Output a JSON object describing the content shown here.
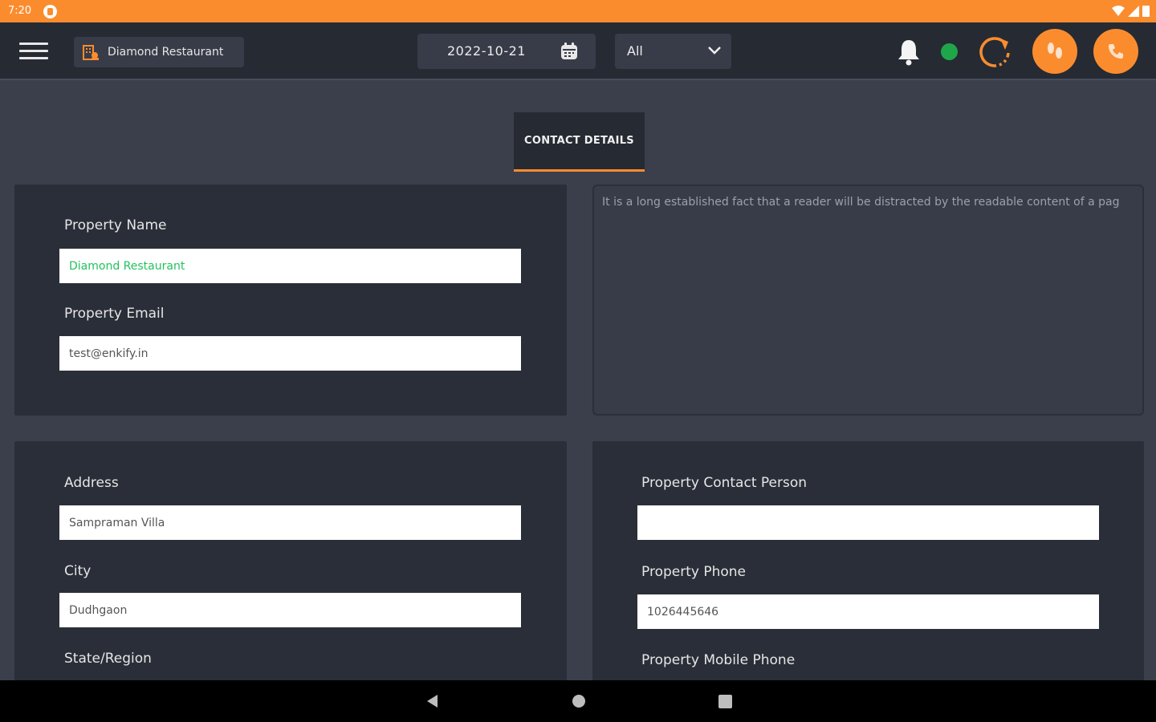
{
  "statusbar": {
    "time": "7:20"
  },
  "header": {
    "property_name": "Diamond Restaurant",
    "date": "2022-10-21",
    "filter_value": "All"
  },
  "tab": {
    "label": "CONTACT DETAILS"
  },
  "form": {
    "property_name_label": "Property Name",
    "property_name_value": "Diamond Restaurant",
    "property_email_label": "Property Email",
    "property_email_value": "test@enkify.in",
    "description_text": "It is a long established fact that a reader will be distracted by the readable content of a pag",
    "address_label": "Address",
    "address_value": "Sampraman Villa",
    "city_label": "City",
    "city_value": "Dudhgaon",
    "state_label": "State/Region",
    "contact_person_label": "Property Contact Person",
    "contact_person_value": "",
    "phone_label": "Property Phone",
    "phone_value": "1026445646",
    "mobile_label": "Property Mobile Phone"
  },
  "colors": {
    "accent": "#fb8c2e",
    "online": "#1fa64a",
    "input_green_text": "#22c35e"
  },
  "icons": [
    "menu-icon",
    "building-icon",
    "calendar-icon",
    "chevron-down-icon",
    "bell-icon",
    "status-dot",
    "refresh-icon",
    "footprints-icon",
    "phone-icon",
    "back-icon",
    "home-icon",
    "recents-icon"
  ]
}
